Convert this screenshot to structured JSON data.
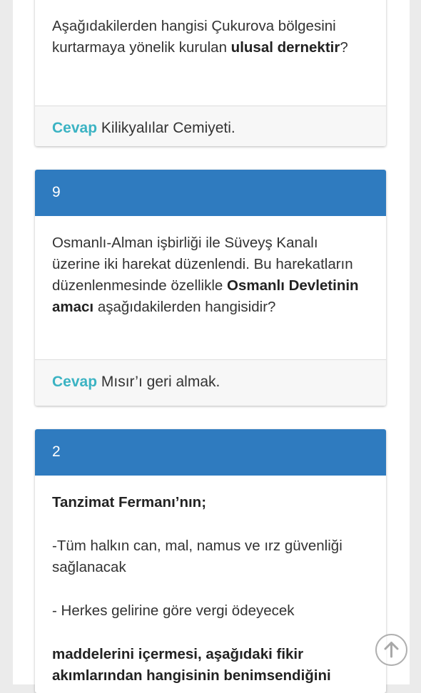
{
  "cards": [
    {
      "question": {
        "line1": "Aşağıdakilerden hangisi Çukurova bölgesini",
        "line2_pre": "kurtarmaya yönelik kurulan ",
        "line2_bold": "ulusal dernektir",
        "line2_post": "?"
      },
      "answer_label": "Cevap",
      "answer_text": "Kilikyalılar Cemiyeti."
    },
    {
      "number": "9",
      "question": {
        "line1": "Osmanlı-Alman işbirliği ile Süveyş Kanalı",
        "line2": "üzerine iki harekat düzenlendi. Bu harekatların",
        "line3_pre": "düzenlenmesinde özellikle ",
        "line3_bold": "Osmanlı Devletinin",
        "line4_bold": "amacı",
        "line4_post": " aşağıdakilerden hangisidir?"
      },
      "answer_label": "Cevap",
      "answer_text": "Mısır’ı geri almak."
    },
    {
      "number": "2",
      "question": {
        "title_bold": "Tanzimat Fermanı’nın;",
        "item1_line1": "-Tüm halkın can, mal, namus ve ırz güvenliği",
        "item1_line2": "sağlanacak",
        "item2": "- Herkes gelirine göre vergi ödeyecek",
        "end_line1_bold": "maddelerini içermesi, aşağıdaki fikir",
        "end_line2_bold": "akımlarından hangisinin benimsendiğini"
      }
    }
  ],
  "scroll_top": {
    "icon": "arrow-up-icon"
  },
  "colors": {
    "header": "#2f7bbf",
    "answer_label": "#3bb3c3",
    "footer_bg": "#f7f7f7"
  }
}
